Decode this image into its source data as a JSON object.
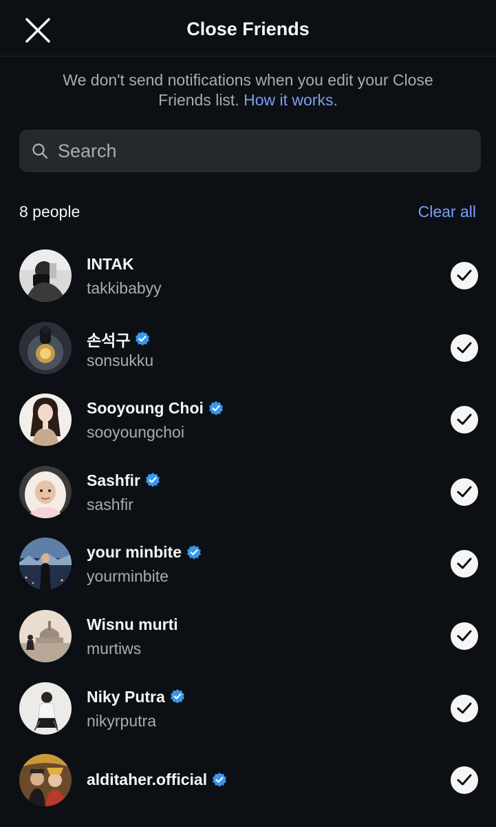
{
  "header": {
    "title": "Close Friends",
    "close_icon": "close-icon"
  },
  "notice": {
    "text": "We don't send notifications when you edit your Close Friends list.",
    "link": "How it works."
  },
  "search": {
    "placeholder": "Search",
    "value": "",
    "icon": "search-icon"
  },
  "list_header": {
    "count": "8 people",
    "clear_all": "Clear all"
  },
  "colors": {
    "background": "#0c1014",
    "accent": "#7b9ef8",
    "verified": "#3897f0",
    "muted_text": "#a8adb3"
  },
  "people": [
    {
      "name": "INTAK",
      "username": "takkibabyy",
      "verified": false,
      "selected": true
    },
    {
      "name": "손석구",
      "username": "sonsukku",
      "verified": true,
      "selected": true
    },
    {
      "name": "Sooyoung Choi",
      "username": "sooyoungchoi",
      "verified": true,
      "selected": true
    },
    {
      "name": "Sashfir",
      "username": "sashfir",
      "verified": true,
      "selected": true
    },
    {
      "name": "your minbite",
      "username": "yourminbite",
      "verified": true,
      "selected": true
    },
    {
      "name": "Wisnu murti",
      "username": "murtiws",
      "verified": false,
      "selected": true
    },
    {
      "name": "Niky Putra",
      "username": "nikyrputra",
      "verified": true,
      "selected": true
    },
    {
      "name": "alditaher.official",
      "username": "",
      "verified": true,
      "selected": true
    }
  ]
}
